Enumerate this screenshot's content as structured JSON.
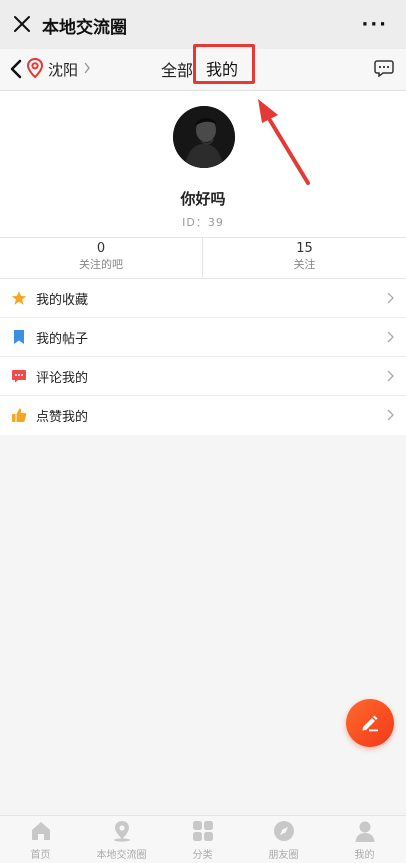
{
  "titlebar": {
    "title": "本地交流圈",
    "more": "···"
  },
  "navbar": {
    "city": "沈阳",
    "tabs": [
      {
        "label": "全部"
      },
      {
        "label": "我的"
      }
    ],
    "active_tab": "我的"
  },
  "profile": {
    "nickname": "你好吗",
    "id_text": "ID：39"
  },
  "stats": [
    {
      "value": "0",
      "label": "关注的吧"
    },
    {
      "value": "15",
      "label": "关注"
    }
  ],
  "menu": [
    {
      "label": "我的收藏",
      "icon": "star-icon",
      "color": "#f5a623"
    },
    {
      "label": "我的帖子",
      "icon": "bookmark-icon",
      "color": "#3d8fe0"
    },
    {
      "label": "评论我的",
      "icon": "comment-icon",
      "color": "#ef4b4b"
    },
    {
      "label": "点赞我的",
      "icon": "thumbs-up-icon",
      "color": "#f5a623"
    }
  ],
  "bottom_nav": [
    {
      "label": "首页",
      "icon": "home-icon"
    },
    {
      "label": "本地交流圈",
      "icon": "location-icon"
    },
    {
      "label": "分类",
      "icon": "grid-icon"
    },
    {
      "label": "朋友圈",
      "icon": "compass-icon"
    },
    {
      "label": "我的",
      "icon": "user-icon"
    }
  ],
  "colors": {
    "accent": "#f2391a",
    "highlight_box": "#e53935"
  }
}
